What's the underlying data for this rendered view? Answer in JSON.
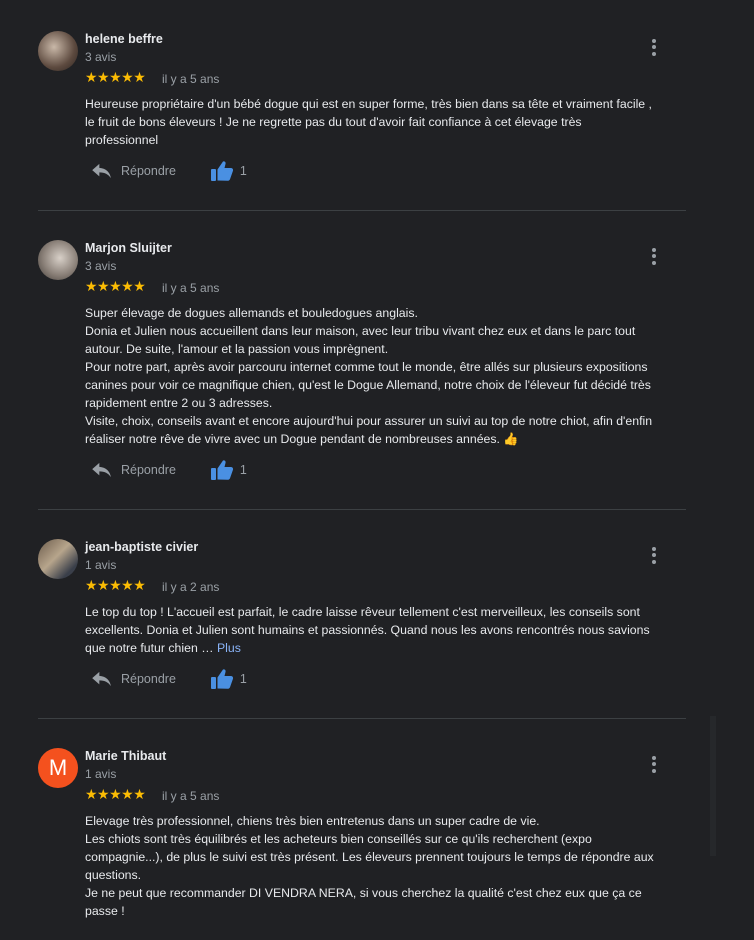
{
  "reviews": [
    {
      "name": "helene beffre",
      "count": "3 avis",
      "stars": "★★★★★",
      "time": "il y a 5 ans",
      "text": "Heureuse propriétaire d'un bébé dogue qui est en super forme, très bien dans sa tête et vraiment facile ,\nle fruit de bons éleveurs ! Je ne regrette pas du tout d'avoir fait confiance à cet élevage très\nprofessionnel",
      "reply_label": "Répondre",
      "likes": "1"
    },
    {
      "name": "Marjon Sluijter",
      "count": "3 avis",
      "stars": "★★★★★",
      "time": "il y a 5 ans",
      "text": "Super élevage de dogues allemands et bouledogues anglais.\nDonia et Julien nous accueillent dans leur maison, avec leur tribu vivant chez eux et dans le parc tout\nautour. De suite, l'amour et la passion vous imprègnent.\nPour notre part, après avoir parcouru internet comme tout le monde, être allés sur plusieurs expositions\ncanines pour voir ce magnifique chien, qu'est le Dogue Allemand, notre choix de l'éleveur fut décidé très\nrapidement entre 2 ou 3 adresses.\nVisite, choix, conseils avant et encore aujourd'hui pour assurer un suivi au top de notre chiot, afin d'enfin\nréaliser notre rêve de vivre avec un Dogue pendant de nombreuses années. 👍",
      "reply_label": "Répondre",
      "likes": "1"
    },
    {
      "name": "jean-baptiste civier",
      "count": "1 avis",
      "stars": "★★★★★",
      "time": "il y a 2 ans",
      "text": "Le top du top ! L'accueil est parfait, le cadre laisse rêveur tellement c'est merveilleux, les conseils sont\nexcellents. Donia et Julien sont humains et passionnés. Quand nous les avons rencontrés nous savions\nque notre futur chien … ",
      "more_link": "Plus",
      "reply_label": "Répondre",
      "likes": "1"
    },
    {
      "name": "Marie Thibaut",
      "initial": "M",
      "count": "1 avis",
      "stars": "★★★★★",
      "time": "il y a 5 ans",
      "text": "Elevage très professionnel, chiens très bien entretenus dans un super cadre de vie.\nLes chiots sont très équilibrés et les acheteurs bien conseillés sur ce qu'ils recherchent (expo\ncompagnie...), de plus le suivi est très présent. Les éleveurs prennent toujours le temps de répondre aux\nquestions.\nJe ne peut que recommander DI VENDRA NERA, si vous cherchez la qualité c'est chez eux que ça ce\npasse !"
    }
  ],
  "colors": {
    "background": "#202124",
    "star": "#fbbc04",
    "like": "#4a90e2",
    "avatar_letter_bg": "#f4511e",
    "link": "#8ab4f8"
  }
}
